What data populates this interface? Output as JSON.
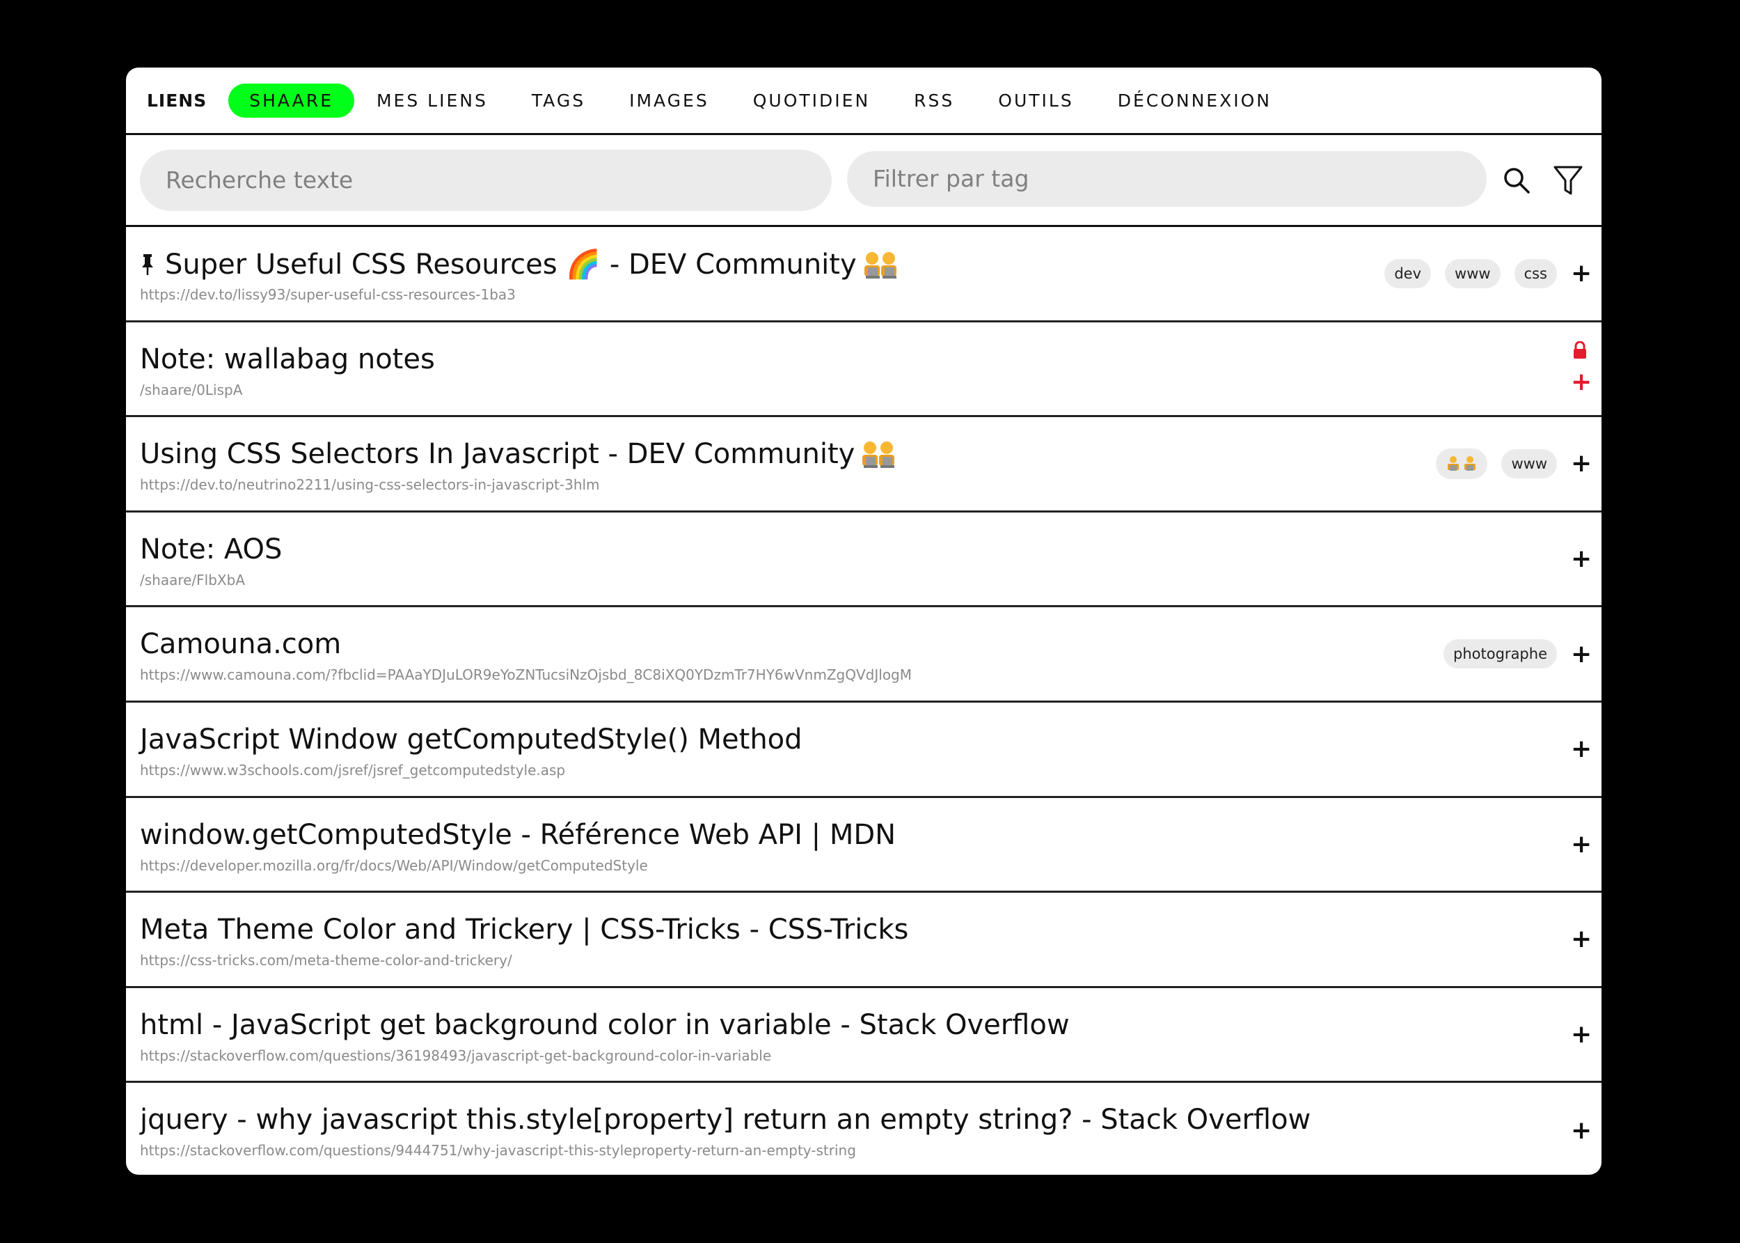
{
  "nav": {
    "brand": "LIENS",
    "items": [
      {
        "label": "SHAARE",
        "active": true
      },
      {
        "label": "MES LIENS"
      },
      {
        "label": "TAGS"
      },
      {
        "label": "IMAGES"
      },
      {
        "label": "QUOTIDIEN"
      },
      {
        "label": "RSS"
      },
      {
        "label": "OUTILS"
      },
      {
        "label": "DÉCONNEXION"
      }
    ]
  },
  "search": {
    "text_placeholder": "Recherche texte",
    "tag_placeholder": "Filtrer par tag"
  },
  "colors": {
    "accent": "#00ff19",
    "private": "#e31c2e",
    "tag_bg": "#ebebeb"
  },
  "links": [
    {
      "title": "Super Useful CSS Resources 🌈 - DEV Community",
      "url": "https://dev.to/lissy93/super-useful-css-resources-1ba3",
      "pinned": true,
      "tags": [
        "dev",
        "www",
        "css"
      ]
    },
    {
      "title": "Note: wallabag notes",
      "url": "/shaare/0LispA",
      "private": true,
      "tags": []
    },
    {
      "title": "Using CSS Selectors In Javascript - DEV Community",
      "url": "https://dev.to/neutrino2211/using-css-selectors-in-javascript-3hlm",
      "tags": [
        "www"
      ]
    },
    {
      "title": "Note: AOS",
      "url": "/shaare/FlbXbA",
      "tags": []
    },
    {
      "title": "Camouna.com",
      "url": "https://www.camouna.com/?fbclid=PAAaYDJuLOR9eYoZNTucsiNzOjsbd_8C8iXQ0YDzmTr7HY6wVnmZgQVdJlogM",
      "tags": [
        "photographe"
      ]
    },
    {
      "title": "JavaScript Window getComputedStyle() Method",
      "url": "https://www.w3schools.com/jsref/jsref_getcomputedstyle.asp",
      "tags": []
    },
    {
      "title": "window.getComputedStyle - Référence Web API | MDN",
      "url": "https://developer.mozilla.org/fr/docs/Web/API/Window/getComputedStyle",
      "tags": []
    },
    {
      "title": "Meta Theme Color and Trickery | CSS-Tricks - CSS-Tricks",
      "url": "https://css-tricks.com/meta-theme-color-and-trickery/",
      "tags": []
    },
    {
      "title": "html - JavaScript get background color in variable - Stack Overflow",
      "url": "https://stackoverflow.com/questions/36198493/javascript-get-background-color-in-variable",
      "tags": []
    },
    {
      "title": "jquery - why javascript this.style[property] return an empty string? - Stack Overflow",
      "url": "https://stackoverflow.com/questions/9444751/why-javascript-this-styleproperty-return-an-empty-string",
      "tags": []
    }
  ],
  "icons": {
    "plus": "+"
  }
}
